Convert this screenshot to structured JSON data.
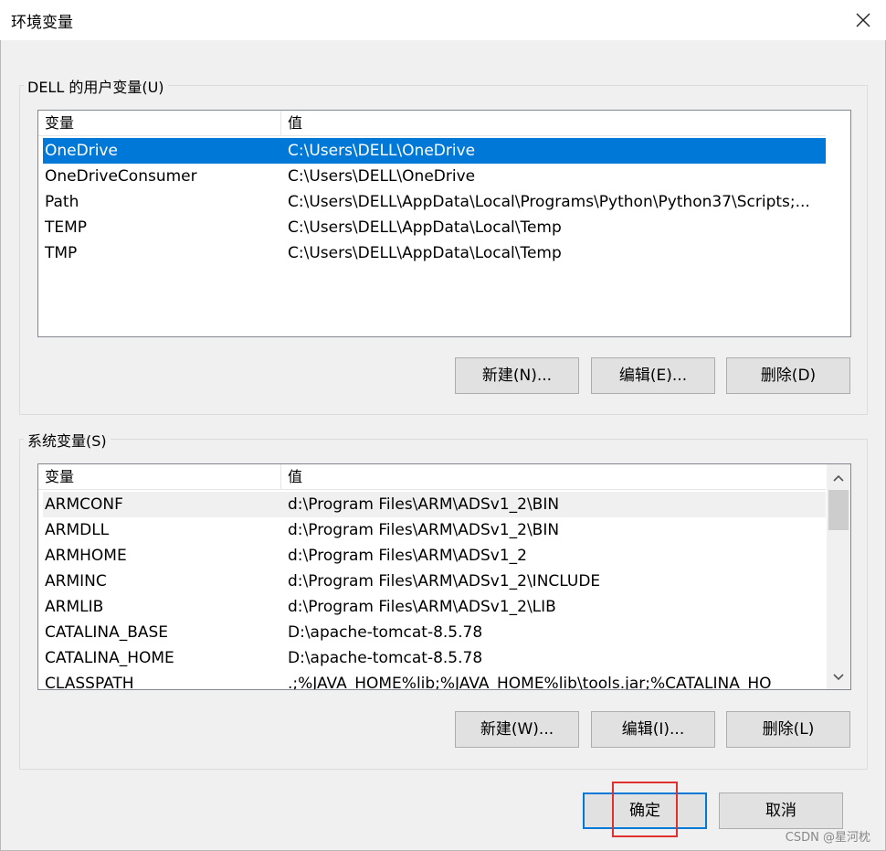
{
  "window": {
    "title": "环境变量"
  },
  "user_vars": {
    "group_label": "DELL 的用户变量(U)",
    "headers": {
      "name": "变量",
      "value": "值"
    },
    "rows": [
      {
        "name": "OneDrive",
        "value": "C:\\Users\\DELL\\OneDrive",
        "selected": true
      },
      {
        "name": "OneDriveConsumer",
        "value": "C:\\Users\\DELL\\OneDrive"
      },
      {
        "name": "Path",
        "value": "C:\\Users\\DELL\\AppData\\Local\\Programs\\Python\\Python37\\Scripts;..."
      },
      {
        "name": "TEMP",
        "value": "C:\\Users\\DELL\\AppData\\Local\\Temp"
      },
      {
        "name": "TMP",
        "value": "C:\\Users\\DELL\\AppData\\Local\\Temp"
      }
    ],
    "buttons": {
      "new": "新建(N)...",
      "edit": "编辑(E)...",
      "delete": "删除(D)"
    }
  },
  "system_vars": {
    "group_label": "系统变量(S)",
    "headers": {
      "name": "变量",
      "value": "值"
    },
    "rows": [
      {
        "name": "ARMCONF",
        "value": "d:\\Program Files\\ARM\\ADSv1_2\\BIN",
        "hover": true
      },
      {
        "name": "ARMDLL",
        "value": "d:\\Program Files\\ARM\\ADSv1_2\\BIN"
      },
      {
        "name": "ARMHOME",
        "value": "d:\\Program Files\\ARM\\ADSv1_2"
      },
      {
        "name": "ARMINC",
        "value": "d:\\Program Files\\ARM\\ADSv1_2\\INCLUDE"
      },
      {
        "name": "ARMLIB",
        "value": "d:\\Program Files\\ARM\\ADSv1_2\\LIB"
      },
      {
        "name": "CATALINA_BASE",
        "value": "D:\\apache-tomcat-8.5.78"
      },
      {
        "name": "CATALINA_HOME",
        "value": "D:\\apache-tomcat-8.5.78"
      },
      {
        "name": "CLASSPATH",
        "value": ".;%JAVA_HOME%lib;%JAVA_HOME%lib\\tools.jar;%CATALINA_HO"
      }
    ],
    "buttons": {
      "new": "新建(W)...",
      "edit": "编辑(I)...",
      "delete": "删除(L)"
    }
  },
  "footer": {
    "ok": "确定",
    "cancel": "取消"
  },
  "watermark": "CSDN @星河枕",
  "colors": {
    "selection": "#0078d7",
    "highlight_annotation": "#e03030"
  }
}
